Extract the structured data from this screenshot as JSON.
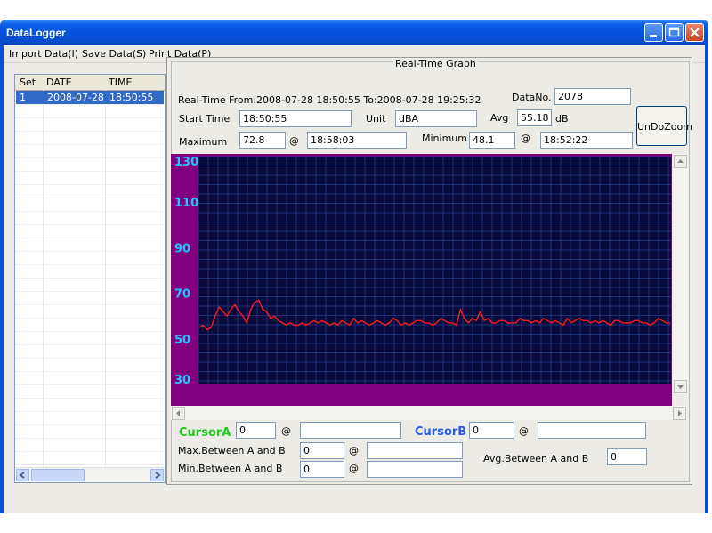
{
  "window": {
    "title": "DataLogger"
  },
  "menu": [
    {
      "label": "Import Data(I)"
    },
    {
      "label": "Save Data(S)"
    },
    {
      "label": "Print Data(P)"
    }
  ],
  "list": {
    "columns": [
      "Set",
      "DATE",
      "TIME"
    ],
    "rows": [
      {
        "set": "1",
        "date": "2008-07-28",
        "time": "18:50:55"
      }
    ]
  },
  "graph": {
    "group_title": "Real-Time Graph",
    "range_text": "Real-Time From:2008-07-28 18:50:55 To:2008-07-28 19:25:32",
    "datano_label": "DataNo.",
    "datano_value": "2078",
    "start_time_label": "Start Time",
    "start_time_value": "18:50:55",
    "unit_label": "Unit",
    "unit_value": "dBA",
    "avg_label": "Avg",
    "avg_value": "55.18",
    "avg_unit": "dB",
    "undo_zoom_label": "UnDoZoom",
    "maximum_label": "Maximum",
    "maximum_value": "72.8",
    "maximum_at": "@",
    "maximum_time": "18:58:03",
    "minimum_label": "Minimum",
    "minimum_value": "48.1",
    "minimum_at": "@",
    "minimum_time": "18:52:22"
  },
  "cursors": {
    "a_label": "CursorA",
    "a_value": "0",
    "a_at": "@",
    "a_time": "",
    "b_label": "CursorB",
    "b_value": "0",
    "b_at": "@",
    "b_time": "",
    "max_label": "Max.Between A and B",
    "max_value": "0",
    "max_at": "@",
    "max_time": "",
    "min_label": "Min.Between A and B",
    "min_value": "0",
    "min_at": "@",
    "min_time": "",
    "avg_label": "Avg.Between A and B",
    "avg_value": "0"
  },
  "colors": {
    "plot_bg": "#0a0a3a",
    "grid": "#1e3d8a",
    "axis_band": "#800080",
    "signal": "#ff1a1a",
    "tick_text": "#1ec8ff",
    "cursor_a": "#22c822",
    "cursor_b": "#2c5cdc"
  },
  "chart_data": {
    "type": "line",
    "title": "",
    "xlabel": "",
    "ylabel": "",
    "y_ticks": [
      130,
      110,
      90,
      70,
      50,
      30
    ],
    "ylim": [
      30,
      130
    ],
    "x_range": [
      "18:50:55",
      "19:25:32"
    ],
    "series": [
      {
        "values": [
          55,
          56,
          54,
          55,
          60,
          64,
          62,
          60,
          63,
          65,
          62,
          60,
          57,
          63,
          66,
          67,
          63,
          62,
          59,
          60,
          58,
          57,
          56,
          57,
          56,
          56,
          57,
          56,
          57,
          58,
          57,
          58,
          57,
          56,
          57,
          56,
          58,
          57,
          56,
          59,
          57,
          58,
          57,
          56,
          57,
          58,
          57,
          56,
          57,
          59,
          58,
          56,
          57,
          56,
          57,
          58,
          58,
          57,
          57,
          56,
          57,
          59,
          58,
          57,
          57,
          56,
          63,
          59,
          57,
          59,
          58,
          62,
          58,
          59,
          57,
          57,
          58,
          58,
          57,
          57,
          57,
          59,
          58,
          58,
          57,
          58,
          57,
          59,
          58,
          57,
          58,
          57,
          56,
          59,
          57,
          58,
          59,
          58,
          58,
          57,
          58,
          57,
          58,
          57,
          56,
          58,
          58,
          57,
          57,
          57,
          58,
          58,
          57,
          57,
          56,
          57,
          59,
          58,
          57,
          57
        ]
      }
    ]
  }
}
